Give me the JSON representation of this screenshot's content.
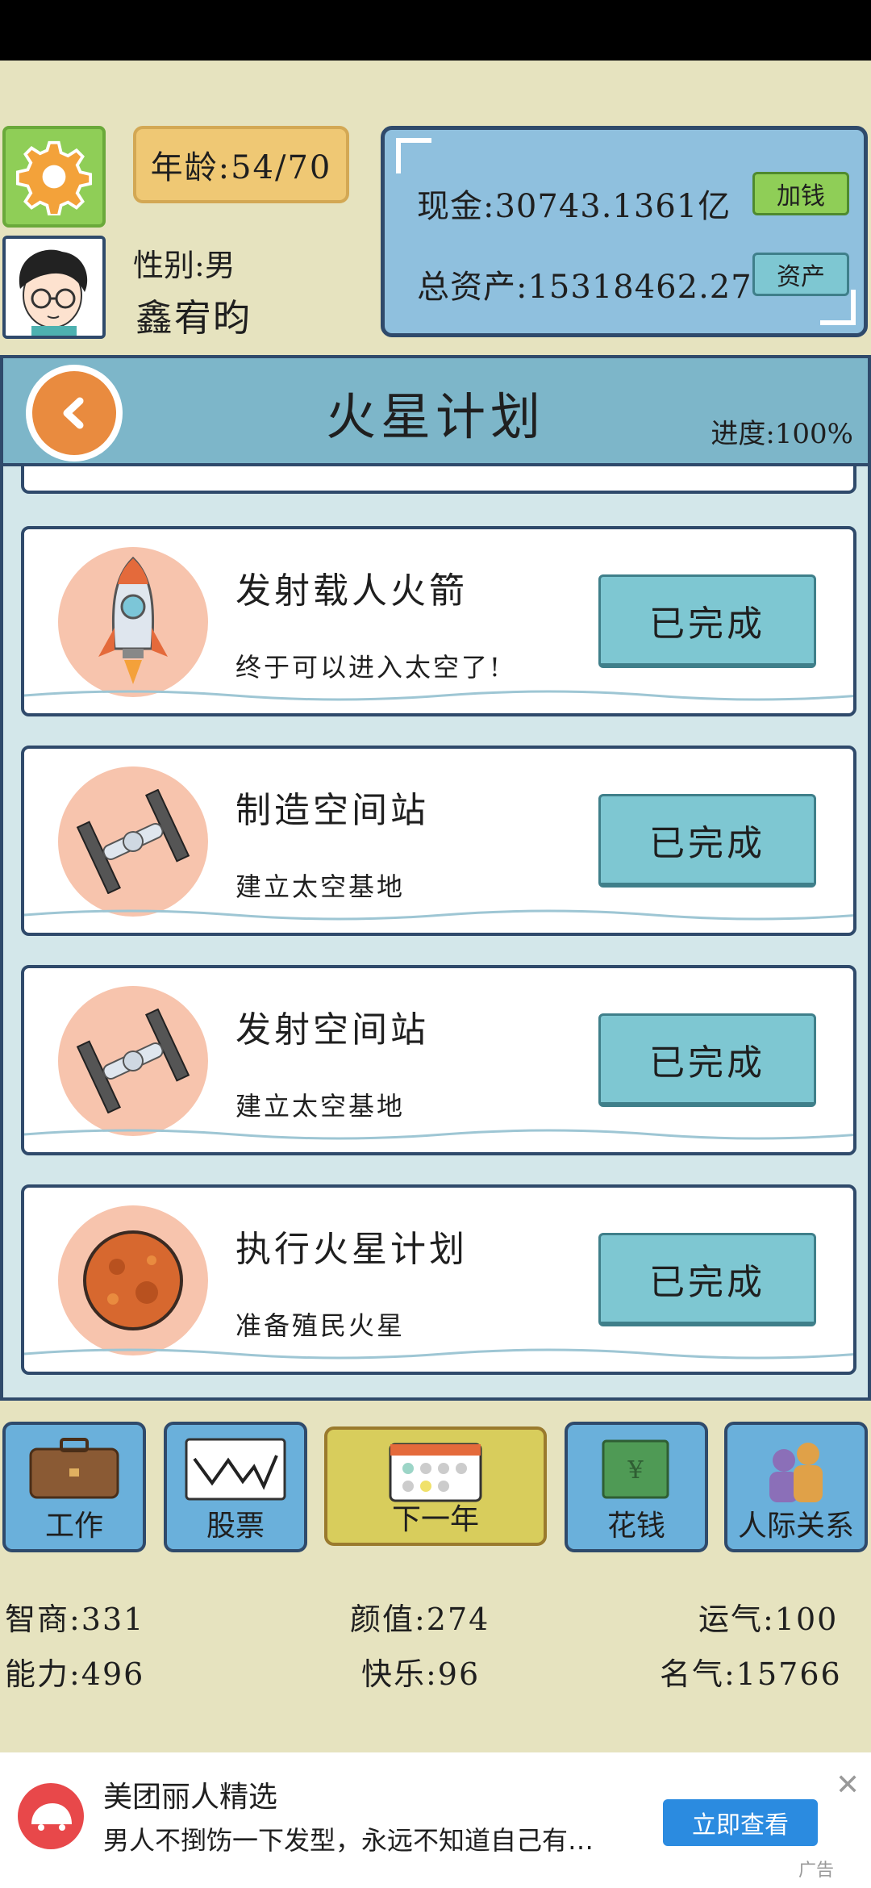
{
  "player": {
    "age_label": "年龄:54/70",
    "gender_label": "性别:男",
    "name": "鑫宥昀"
  },
  "finance": {
    "cash_label": "现金:30743.1361亿",
    "add_money_button": "加钱",
    "total_assets_label": "总资产:15318462.27",
    "assets_button": "资产"
  },
  "dialog": {
    "title": "火星计划",
    "progress_label": "进度:100%",
    "tasks": [
      {
        "title": "发射载人火箭",
        "desc": "终于可以进入太空了!",
        "status": "已完成",
        "icon": "rocket-icon"
      },
      {
        "title": "制造空间站",
        "desc": "建立太空基地",
        "status": "已完成",
        "icon": "space-station-icon"
      },
      {
        "title": "发射空间站",
        "desc": "建立太空基地",
        "status": "已完成",
        "icon": "space-station-icon"
      },
      {
        "title": "执行火星计划",
        "desc": "准备殖民火星",
        "status": "已完成",
        "icon": "mars-planet-icon"
      }
    ]
  },
  "nav": {
    "work": "工作",
    "stocks": "股票",
    "next_year": "下一年",
    "spend": "花钱",
    "relations": "人际关系"
  },
  "stats": {
    "iq": "智商:331",
    "looks": "颜值:274",
    "luck": "运气:100",
    "ability": "能力:496",
    "happiness": "快乐:96",
    "fame": "名气:15766"
  },
  "ad": {
    "title": "美团丽人精选",
    "text": "男人不捯饬一下发型，永远不知道自己有…",
    "button": "立即查看",
    "tag": "广告",
    "close": "✕"
  },
  "colors": {
    "background": "#e6e3bf",
    "panel_blue": "#8fc0de",
    "button_teal": "#7ec7d2",
    "accent_green": "#8fce57",
    "border_navy": "#2f4a6b"
  }
}
